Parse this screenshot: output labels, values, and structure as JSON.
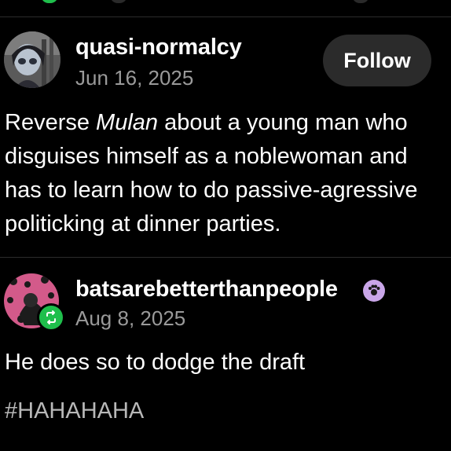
{
  "post1": {
    "username": "quasi-normalcy",
    "date": "Jun 16, 2025",
    "follow_label": "Follow",
    "text_line1_pre": "Reverse ",
    "text_line1_em": "Mulan",
    "text_line1_post": " about a young man who",
    "text_line2": "disguises himself as a noblewoman and",
    "text_line3": "has to learn how to do passive-agressive",
    "text_line4": "politicking at dinner parties."
  },
  "post2": {
    "username": "batsarebetterthanpeople",
    "date": "Aug 8, 2025",
    "text": "He does so to dodge the draft",
    "tag": "#HAHAHAHA"
  },
  "colors": {
    "background": "#000000",
    "follow_button": "#2b2b2b",
    "reblog_green": "#1fbf4c",
    "badge_purple": "#c9a6e8",
    "muted_text": "#9a9a9a"
  },
  "icons": {
    "reblog": "reblog-icon",
    "badge": "paw-badge-icon"
  }
}
